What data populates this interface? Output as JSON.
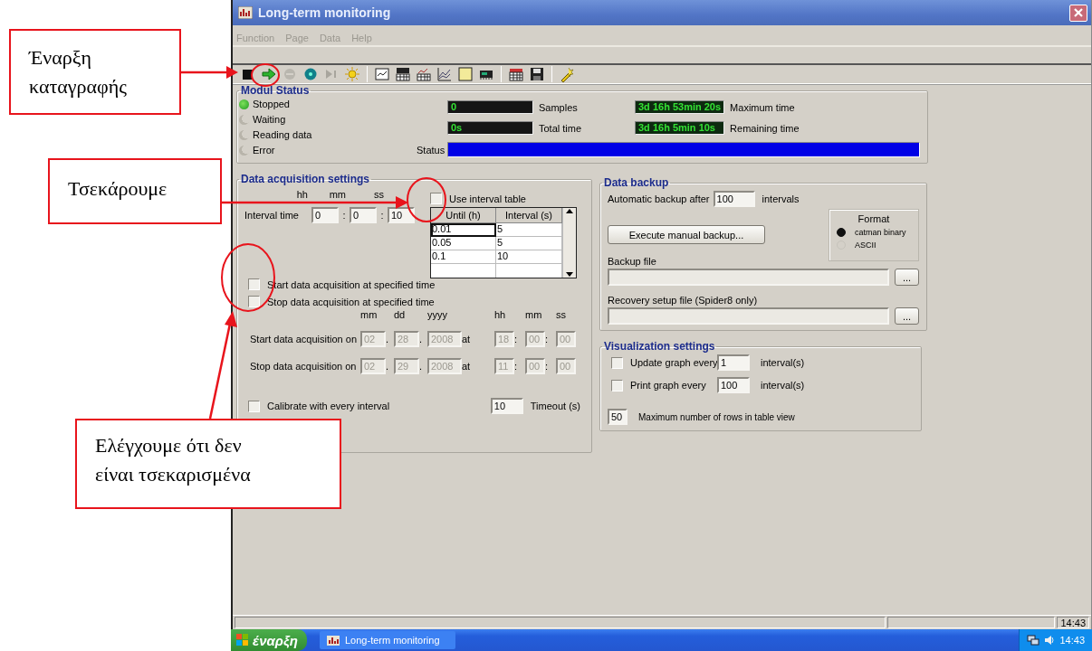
{
  "annotations": [
    {
      "text": "Έναρξη\nκαταγραφής"
    },
    {
      "text": "Τσεκάρουμε"
    },
    {
      "text": "Ελέγχουμε ότι δεν\nείναι τσεκαρισμένα"
    }
  ],
  "window": {
    "title": "Long-term monitoring"
  },
  "menu": [
    {
      "label": "Function",
      "disabled": true
    },
    {
      "label": "Page",
      "disabled": true
    },
    {
      "label": "Data",
      "disabled": true
    },
    {
      "label": "Help",
      "disabled": true
    }
  ],
  "modul_status": {
    "title": "Modul Status",
    "states": [
      {
        "label": "Stopped",
        "on": true
      },
      {
        "label": "Waiting",
        "on": false
      },
      {
        "label": "Reading data",
        "on": false
      },
      {
        "label": "Error",
        "on": false
      }
    ],
    "counters": [
      {
        "value": "0",
        "label": "Samples"
      },
      {
        "value": "3d 16h 53min 20s",
        "label": "Maximum time"
      },
      {
        "value": "0s",
        "label": "Total time"
      },
      {
        "value": "3d 16h 5min 10s",
        "label": "Remaining time"
      }
    ],
    "status": {
      "label": "Status",
      "level": 1
    }
  },
  "acquisition": {
    "title": "Data acquisition settings",
    "interval": {
      "label": "Interval time",
      "units": [
        "hh",
        "mm",
        "ss"
      ],
      "values": [
        "0",
        "0",
        "10"
      ],
      "separator": ":"
    },
    "use_table": {
      "label": "Use interval table",
      "checked": false
    },
    "table": {
      "columns": [
        "Until (h)",
        "Interval (s)"
      ],
      "rows": [
        {
          "cells": [
            "0.01",
            "5"
          ],
          "selected": true
        },
        {
          "cells": [
            "0.05",
            "5"
          ],
          "selected": false
        },
        {
          "cells": [
            "0.1",
            "10"
          ],
          "selected": false
        }
      ]
    },
    "options": [
      {
        "label": "Start data acquisition at specified time",
        "checked": false
      },
      {
        "label": "Stop data acquisition at specified time",
        "checked": false
      }
    ],
    "date_units": [
      "mm",
      "dd",
      "yyyy"
    ],
    "time_units": [
      "hh",
      "mm",
      "ss"
    ],
    "schedule": [
      {
        "label": "Start data acquisition on",
        "date": [
          "02",
          "28",
          "2008"
        ],
        "at": "at",
        "time": [
          "18",
          "00",
          "00"
        ],
        "disabled": true
      },
      {
        "label": "Stop data acquisition on",
        "date": [
          "02",
          "29",
          "2008"
        ],
        "at": "at",
        "time": [
          "11",
          "00",
          "00"
        ],
        "disabled": true
      }
    ],
    "date_separator": ".",
    "time_separator": ":",
    "calibrate": {
      "label": "Calibrate with every interval",
      "checked": false
    },
    "timeout": {
      "value": "10",
      "label": "Timeout (s)"
    }
  },
  "backup": {
    "title": "Data backup",
    "auto_label": "Automatic backup after",
    "auto_value": "100",
    "auto_unit": "intervals",
    "button": "Execute manual backup...",
    "format": {
      "title": "Format",
      "options": [
        {
          "label": "catman binary",
          "selected": true
        },
        {
          "label": "ASCII",
          "selected": false
        }
      ]
    },
    "files": [
      {
        "label": "Backup file",
        "button": "..."
      },
      {
        "label": "Recovery setup file (Spider8 only)",
        "button": "..."
      }
    ]
  },
  "visualization": {
    "title": "Visualization settings",
    "rows": [
      {
        "kind": "checkbox",
        "label": "Update graph every",
        "value": "1",
        "unit": "interval(s)",
        "checked": false
      },
      {
        "kind": "checkbox",
        "label": "Print graph every",
        "value": "100",
        "unit": "interval(s)",
        "checked": false
      },
      {
        "kind": "plain",
        "value": "50",
        "label": "Maximum number of rows in table view"
      }
    ]
  },
  "status_bar": {
    "clock": "14:43"
  },
  "taskbar": {
    "start": "έναρξη",
    "tasks": [
      "Long-term monitoring"
    ],
    "clock": "14:43"
  }
}
